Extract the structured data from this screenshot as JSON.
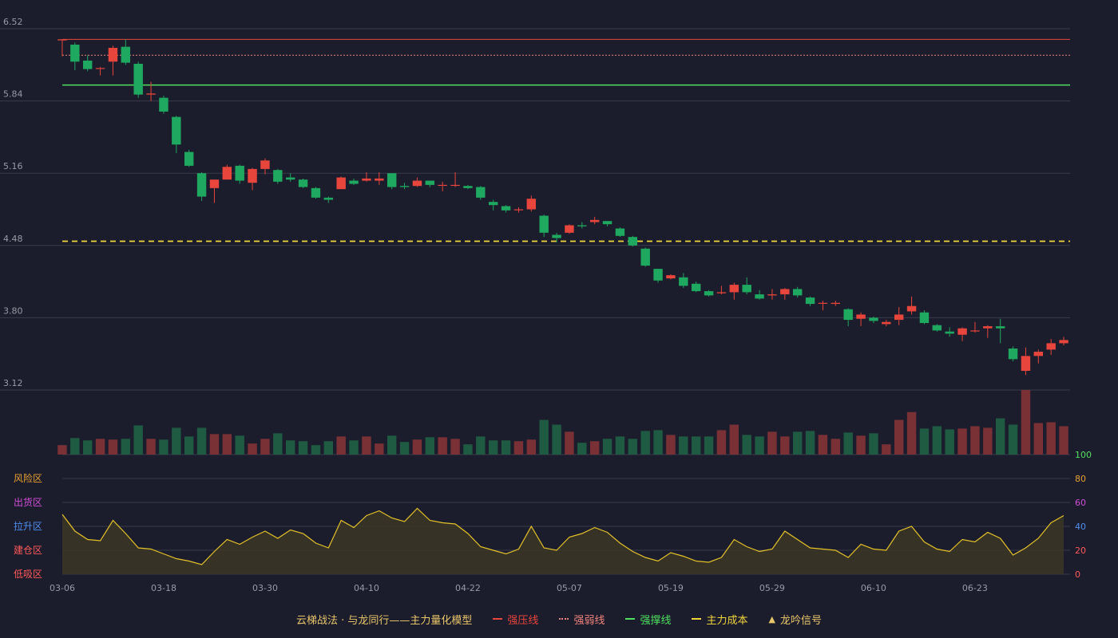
{
  "colors": {
    "background": "#1b1c2c",
    "up": "#e8453c",
    "down": "#1fa85f",
    "up_volume": "#7a3136",
    "down_volume": "#1f5a42",
    "grid": "#3a3b4c",
    "axis_text": "#9a9aa6",
    "pressure_line": "#e8453c",
    "weak_line": "#f0857d",
    "support_line": "#4ee05e",
    "cost_line": "#f2d53c",
    "indicator_line": "#e5c228",
    "indicator_fill": "#3a3526",
    "zone_risk": "#e8a030",
    "zone_distribution": "#d24fd8",
    "zone_markup": "#4f8ff0",
    "zone_build": "#ff5a5a",
    "zone_accumulation": "#ff5a5a",
    "right_axis_100": "#4ee05e",
    "right_axis_80": "#e8a030",
    "right_axis_60": "#d24fd8",
    "right_axis_40": "#4f8ff0",
    "right_axis_20": "#ff5a5a",
    "right_axis_0": "#ff5a5a"
  },
  "legend": {
    "title": "云梯战法 · 与龙同行——主力量化模型",
    "items": [
      {
        "label": "强压线",
        "style": "solid",
        "color": "#e8453c",
        "icon": "line-icon"
      },
      {
        "label": "强弱线",
        "style": "dotted",
        "color": "#f0857d",
        "icon": "line-icon"
      },
      {
        "label": "强撑线",
        "style": "solid",
        "color": "#4ee05e",
        "icon": "line-icon"
      },
      {
        "label": "主力成本",
        "style": "dashed",
        "color": "#f2d53c",
        "icon": "line-icon"
      },
      {
        "label": "龙吟信号",
        "style": "triangle",
        "color": "#e8c66a",
        "icon": "triangle-icon"
      }
    ]
  },
  "chart_data": [
    {
      "type": "candlestick",
      "y_ticks": [
        "6.52",
        "5.84",
        "5.16",
        "4.48",
        "3.80",
        "3.12"
      ],
      "ylim": [
        3.12,
        6.52
      ],
      "x_tick_labels": [
        {
          "index": 0,
          "label": "03-06"
        },
        {
          "index": 8,
          "label": "03-18"
        },
        {
          "index": 16,
          "label": "03-30"
        },
        {
          "index": 24,
          "label": "04-10"
        },
        {
          "index": 32,
          "label": "04-22"
        },
        {
          "index": 40,
          "label": "05-07"
        },
        {
          "index": 48,
          "label": "05-19"
        },
        {
          "index": 56,
          "label": "05-29"
        },
        {
          "index": 64,
          "label": "06-10"
        },
        {
          "index": 72,
          "label": "06-23"
        }
      ],
      "reference_lines": {
        "strong_pressure": 6.42,
        "strong_weak": 6.27,
        "strong_support": 5.99,
        "main_cost": 4.52
      },
      "candles": [
        [
          6.41,
          6.42,
          6.26,
          6.42
        ],
        [
          6.37,
          6.21,
          6.13,
          6.39
        ],
        [
          6.22,
          6.14,
          6.12,
          6.27
        ],
        [
          6.15,
          6.15,
          6.08,
          6.16
        ],
        [
          6.21,
          6.34,
          6.08,
          6.36
        ],
        [
          6.35,
          6.2,
          6.18,
          6.42
        ],
        [
          6.19,
          5.9,
          5.87,
          6.21
        ],
        [
          5.9,
          5.91,
          5.84,
          6.02
        ],
        [
          5.87,
          5.74,
          5.72,
          5.89
        ],
        [
          5.69,
          5.43,
          5.35,
          5.7
        ],
        [
          5.36,
          5.23,
          5.22,
          5.38
        ],
        [
          5.16,
          4.94,
          4.9,
          5.17
        ],
        [
          5.02,
          5.1,
          4.88,
          5.1
        ],
        [
          5.1,
          5.22,
          5.1,
          5.24
        ],
        [
          5.23,
          5.09,
          5.06,
          5.24
        ],
        [
          5.07,
          5.2,
          5.0,
          5.21
        ],
        [
          5.2,
          5.28,
          5.15,
          5.3
        ],
        [
          5.19,
          5.08,
          5.06,
          5.2
        ],
        [
          5.12,
          5.1,
          5.08,
          5.16
        ],
        [
          5.1,
          5.03,
          5.02,
          5.11
        ],
        [
          5.02,
          4.93,
          4.92,
          5.03
        ],
        [
          4.93,
          4.91,
          4.88,
          4.94
        ],
        [
          5.01,
          5.12,
          5.01,
          5.13
        ],
        [
          5.09,
          5.06,
          5.05,
          5.11
        ],
        [
          5.09,
          5.11,
          5.08,
          5.17
        ],
        [
          5.09,
          5.11,
          5.05,
          5.17
        ],
        [
          5.16,
          5.03,
          5.01,
          5.16
        ],
        [
          5.04,
          5.03,
          5.01,
          5.07
        ],
        [
          5.04,
          5.09,
          5.03,
          5.12
        ],
        [
          5.09,
          5.05,
          5.03,
          5.09
        ],
        [
          5.05,
          5.05,
          4.99,
          5.08
        ],
        [
          5.05,
          5.05,
          5.03,
          5.17
        ],
        [
          5.04,
          5.02,
          5.01,
          5.05
        ],
        [
          5.03,
          4.93,
          4.91,
          5.04
        ],
        [
          4.89,
          4.86,
          4.81,
          4.91
        ],
        [
          4.85,
          4.81,
          4.79,
          4.86
        ],
        [
          4.82,
          4.82,
          4.79,
          4.84
        ],
        [
          4.82,
          4.92,
          4.8,
          4.95
        ],
        [
          4.76,
          4.6,
          4.56,
          4.77
        ],
        [
          4.58,
          4.55,
          4.51,
          4.6
        ],
        [
          4.6,
          4.67,
          4.59,
          4.68
        ],
        [
          4.67,
          4.66,
          4.64,
          4.7
        ],
        [
          4.7,
          4.72,
          4.68,
          4.75
        ],
        [
          4.71,
          4.68,
          4.66,
          4.71
        ],
        [
          4.64,
          4.57,
          4.56,
          4.65
        ],
        [
          4.56,
          4.48,
          4.47,
          4.57
        ],
        [
          4.45,
          4.29,
          4.28,
          4.46
        ],
        [
          4.26,
          4.15,
          4.13,
          4.26
        ],
        [
          4.17,
          4.2,
          4.16,
          4.21
        ],
        [
          4.18,
          4.1,
          4.08,
          4.22
        ],
        [
          4.12,
          4.05,
          4.04,
          4.14
        ],
        [
          4.05,
          4.01,
          4.0,
          4.06
        ],
        [
          4.03,
          4.04,
          4.02,
          4.1
        ],
        [
          4.04,
          4.11,
          3.97,
          4.13
        ],
        [
          4.11,
          4.04,
          4.02,
          4.18
        ],
        [
          4.02,
          3.98,
          3.97,
          4.06
        ],
        [
          4.01,
          4.02,
          3.97,
          4.07
        ],
        [
          4.02,
          4.07,
          3.97,
          4.08
        ],
        [
          4.07,
          4.01,
          3.99,
          4.09
        ],
        [
          3.99,
          3.93,
          3.91,
          4.0
        ],
        [
          3.94,
          3.94,
          3.87,
          3.96
        ],
        [
          3.93,
          3.94,
          3.91,
          3.96
        ],
        [
          3.88,
          3.78,
          3.72,
          3.89
        ],
        [
          3.79,
          3.83,
          3.72,
          3.85
        ],
        [
          3.8,
          3.77,
          3.75,
          3.81
        ],
        [
          3.74,
          3.76,
          3.72,
          3.78
        ],
        [
          3.78,
          3.83,
          3.73,
          3.9
        ],
        [
          3.86,
          3.91,
          3.83,
          4.0
        ],
        [
          3.85,
          3.75,
          3.74,
          3.87
        ],
        [
          3.73,
          3.68,
          3.67,
          3.74
        ],
        [
          3.67,
          3.65,
          3.62,
          3.71
        ],
        [
          3.64,
          3.7,
          3.58,
          3.71
        ],
        [
          3.68,
          3.68,
          3.66,
          3.76
        ],
        [
          3.7,
          3.72,
          3.61,
          3.73
        ],
        [
          3.72,
          3.7,
          3.56,
          3.79
        ],
        [
          3.51,
          3.41,
          3.39,
          3.53
        ],
        [
          3.3,
          3.44,
          3.26,
          3.52
        ],
        [
          3.44,
          3.48,
          3.37,
          3.5
        ],
        [
          3.5,
          3.56,
          3.45,
          3.6
        ],
        [
          3.56,
          3.59,
          3.54,
          3.62
        ]
      ]
    },
    {
      "type": "bar",
      "name": "volume",
      "values": [
        12,
        21,
        18,
        20,
        19,
        20,
        37,
        20,
        19,
        34,
        23,
        34,
        26,
        26,
        24,
        14,
        20,
        27,
        18,
        17,
        12,
        17,
        23,
        18,
        23,
        14,
        24,
        16,
        19,
        22,
        22,
        20,
        13,
        23,
        18,
        18,
        17,
        19,
        44,
        38,
        29,
        15,
        17,
        20,
        23,
        20,
        30,
        31,
        25,
        23,
        23,
        23,
        31,
        38,
        25,
        23,
        29,
        23,
        29,
        30,
        25,
        20,
        28,
        24,
        27,
        13,
        44,
        54,
        33,
        36,
        32,
        33,
        36,
        34,
        46,
        38,
        82,
        40,
        41,
        36
      ]
    },
    {
      "type": "area",
      "name": "indicator",
      "y_ticks": [
        "100",
        "80",
        "60",
        "40",
        "20",
        "0"
      ],
      "ylim": [
        0,
        100
      ],
      "zones": [
        "风险区",
        "出货区",
        "拉升区",
        "建仓区",
        "低吸区"
      ],
      "values": [
        50,
        36,
        29,
        28,
        45,
        34,
        22,
        21,
        17,
        13,
        11,
        8,
        19,
        29,
        25,
        31,
        36,
        30,
        37,
        34,
        26,
        22,
        45,
        39,
        49,
        53,
        47,
        44,
        55,
        45,
        43,
        42,
        34,
        23,
        20,
        17,
        21,
        40,
        22,
        20,
        31,
        34,
        39,
        35,
        26,
        19,
        14,
        11,
        18,
        15,
        11,
        10,
        14,
        29,
        23,
        19,
        21,
        36,
        29,
        22,
        21,
        20,
        14,
        25,
        21,
        20,
        36,
        40,
        27,
        21,
        19,
        29,
        27,
        35,
        30,
        16,
        22,
        30,
        43,
        49
      ]
    }
  ]
}
